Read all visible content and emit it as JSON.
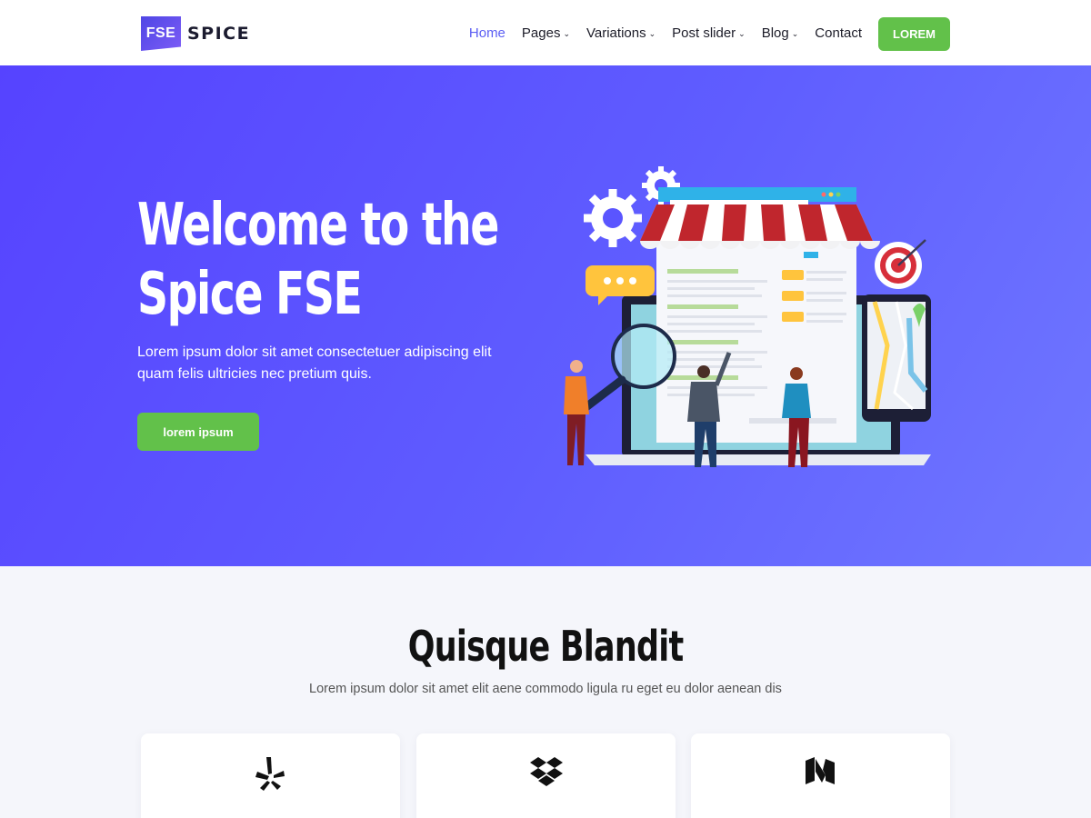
{
  "header": {
    "logo_badge": "FSE",
    "logo_text": "SPICE",
    "nav": [
      "Home",
      "Pages",
      "Variations",
      "Post slider",
      "Blog",
      "Contact"
    ],
    "cta_label": "LOREM"
  },
  "hero": {
    "title_line1": "Welcome to the",
    "title_line2": "Spice FSE",
    "subtitle": "Lorem ipsum dolor sit amet consectetuer adipiscing elit quam felis ultricies nec pretium quis.",
    "button_label": "lorem ipsum",
    "illustration": "online-store-illustration"
  },
  "features": {
    "title": "Quisque Blandit",
    "subtitle": "Lorem ipsum dolor sit amet elit aene commodo ligula ru eget eu dolor aenean dis",
    "cards": [
      {
        "icon": "yelp-icon"
      },
      {
        "icon": "dropbox-icon"
      },
      {
        "icon": "medium-icon"
      }
    ]
  },
  "colors": {
    "accent": "#5b5ef3",
    "hero_bg": "#5a50ff",
    "button_green": "#62c14a"
  }
}
